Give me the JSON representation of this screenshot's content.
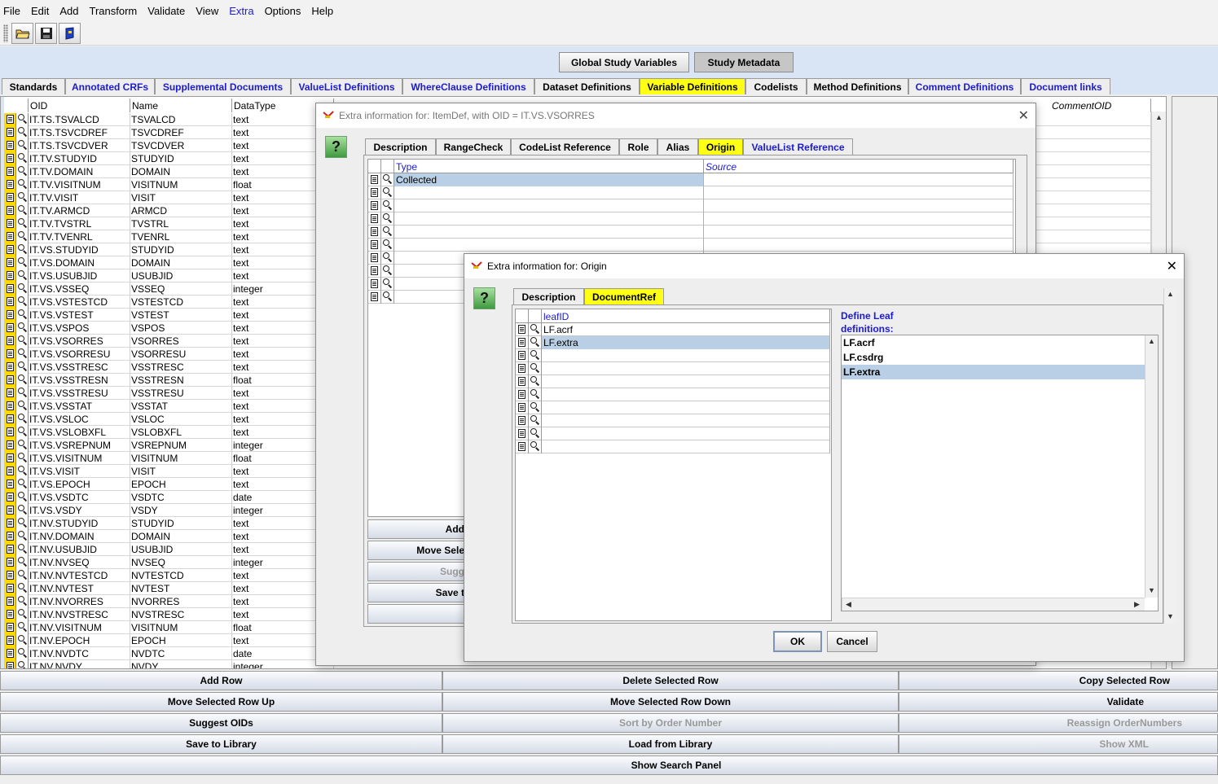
{
  "menu": [
    "File",
    "Edit",
    "Add",
    "Transform",
    "Validate",
    "View",
    "Extra",
    "Options",
    "Help"
  ],
  "toolbar": {
    "icons": [
      "open-folder-icon",
      "save-disk-icon",
      "book-icon"
    ]
  },
  "top_buttons": {
    "global": "Global Study Variables",
    "study": "Study Metadata"
  },
  "main_tabs": [
    "Standards",
    "Annotated CRFs",
    "Supplemental Documents",
    "ValueList Definitions",
    "WhereClause Definitions",
    "Dataset Definitions",
    "Variable Definitions",
    "Codelists",
    "Method Definitions",
    "Comment Definitions",
    "Document links"
  ],
  "table": {
    "headers": [
      "OID",
      "Name",
      "DataType",
      "CommentOID"
    ],
    "rows": [
      [
        "IT.TS.TSVALCD",
        "TSVALCD",
        "text"
      ],
      [
        "IT.TS.TSVCDREF",
        "TSVCDREF",
        "text"
      ],
      [
        "IT.TS.TSVCDVER",
        "TSVCDVER",
        "text"
      ],
      [
        "IT.TV.STUDYID",
        "STUDYID",
        "text"
      ],
      [
        "IT.TV.DOMAIN",
        "DOMAIN",
        "text"
      ],
      [
        "IT.TV.VISITNUM",
        "VISITNUM",
        "float"
      ],
      [
        "IT.TV.VISIT",
        "VISIT",
        "text"
      ],
      [
        "IT.TV.ARMCD",
        "ARMCD",
        "text"
      ],
      [
        "IT.TV.TVSTRL",
        "TVSTRL",
        "text"
      ],
      [
        "IT.TV.TVENRL",
        "TVENRL",
        "text"
      ],
      [
        "IT.VS.STUDYID",
        "STUDYID",
        "text"
      ],
      [
        "IT.VS.DOMAIN",
        "DOMAIN",
        "text"
      ],
      [
        "IT.VS.USUBJID",
        "USUBJID",
        "text"
      ],
      [
        "IT.VS.VSSEQ",
        "VSSEQ",
        "integer"
      ],
      [
        "IT.VS.VSTESTCD",
        "VSTESTCD",
        "text"
      ],
      [
        "IT.VS.VSTEST",
        "VSTEST",
        "text"
      ],
      [
        "IT.VS.VSPOS",
        "VSPOS",
        "text"
      ],
      [
        "IT.VS.VSORRES",
        "VSORRES",
        "text"
      ],
      [
        "IT.VS.VSORRESU",
        "VSORRESU",
        "text"
      ],
      [
        "IT.VS.VSSTRESC",
        "VSSTRESC",
        "text"
      ],
      [
        "IT.VS.VSSTRESN",
        "VSSTRESN",
        "float"
      ],
      [
        "IT.VS.VSSTRESU",
        "VSSTRESU",
        "text"
      ],
      [
        "IT.VS.VSSTAT",
        "VSSTAT",
        "text"
      ],
      [
        "IT.VS.VSLOC",
        "VSLOC",
        "text"
      ],
      [
        "IT.VS.VSLOBXFL",
        "VSLOBXFL",
        "text"
      ],
      [
        "IT.VS.VSREPNUM",
        "VSREPNUM",
        "integer"
      ],
      [
        "IT.VS.VISITNUM",
        "VISITNUM",
        "float"
      ],
      [
        "IT.VS.VISIT",
        "VISIT",
        "text"
      ],
      [
        "IT.VS.EPOCH",
        "EPOCH",
        "text"
      ],
      [
        "IT.VS.VSDTC",
        "VSDTC",
        "date"
      ],
      [
        "IT.VS.VSDY",
        "VSDY",
        "integer"
      ],
      [
        "IT.NV.STUDYID",
        "STUDYID",
        "text"
      ],
      [
        "IT.NV.DOMAIN",
        "DOMAIN",
        "text"
      ],
      [
        "IT.NV.USUBJID",
        "USUBJID",
        "text"
      ],
      [
        "IT.NV.NVSEQ",
        "NVSEQ",
        "integer"
      ],
      [
        "IT.NV.NVTESTCD",
        "NVTESTCD",
        "text"
      ],
      [
        "IT.NV.NVTEST",
        "NVTEST",
        "text"
      ],
      [
        "IT.NV.NVORRES",
        "NVORRES",
        "text"
      ],
      [
        "IT.NV.NVSTRESC",
        "NVSTRESC",
        "text"
      ],
      [
        "IT.NV.VISITNUM",
        "VISITNUM",
        "float"
      ],
      [
        "IT.NV.EPOCH",
        "EPOCH",
        "text"
      ],
      [
        "IT.NV.NVDTC",
        "NVDTC",
        "date"
      ],
      [
        "IT.NV.NVDY",
        "NVDY",
        "integer"
      ]
    ]
  },
  "bottom_buttons": {
    "add_row": "Add Row",
    "delete_row": "Delete Selected Row",
    "copy_row": "Copy Selected Row",
    "move_up": "Move Selected Row Up",
    "move_down": "Move Selected Row Down",
    "validate": "Validate",
    "suggest": "Suggest OIDs",
    "sort": "Sort by Order Number",
    "reassign": "Reassign OrderNumbers",
    "save_lib": "Save to Library",
    "load_lib": "Load from Library",
    "show_xml": "Show XML",
    "search": "Show Search Panel"
  },
  "dialog1": {
    "title": "Extra information for: ItemDef, with OID = IT.VS.VSORRES",
    "tabs": [
      "Description",
      "RangeCheck",
      "CodeList Reference",
      "Role",
      "Alias",
      "Origin",
      "ValueList Reference"
    ],
    "headers": [
      "Type",
      "Source"
    ],
    "rows": [
      [
        "Collected",
        ""
      ]
    ],
    "buttons": [
      "Add",
      "Move Sele",
      "Sugg",
      "Save t",
      ""
    ]
  },
  "dialog2": {
    "title": "Extra information for: Origin",
    "tabs": [
      "Description",
      "DocumentRef"
    ],
    "header": "leafID",
    "rows": [
      "LF.acrf",
      "LF.extra"
    ],
    "list_label": "Define Leaf definitions:",
    "list_items": [
      "LF.acrf",
      "LF.csdrg",
      "LF.extra"
    ],
    "ok": "OK",
    "cancel": "Cancel"
  },
  "colors": {
    "selected_tab": "#ffff14",
    "link_blue": "#1b1bd0",
    "selection": "#b8cfe5",
    "background_blue": "#d9e4f4"
  }
}
